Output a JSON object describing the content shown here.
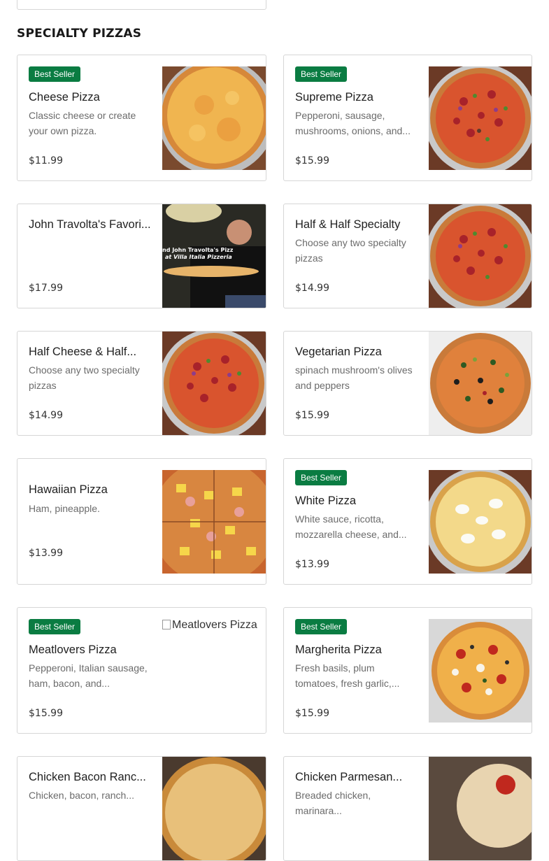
{
  "section": {
    "title": "SPECIALTY PIZZAS"
  },
  "badge_label": "Best Seller",
  "items": [
    {
      "name": "Cheese Pizza",
      "description": "Classic cheese or create your own pizza.",
      "price": "$11.99",
      "best_seller": true,
      "image": "cheese-pizza"
    },
    {
      "name": "Supreme Pizza",
      "description": "Pepperoni, sausage, mushrooms, onions, and...",
      "price": "$15.99",
      "best_seller": true,
      "image": "supreme-pizza"
    },
    {
      "name": "John Travolta's Favori...",
      "description": "",
      "price": "$17.99",
      "best_seller": false,
      "image": "john-travolta-photo",
      "image_caption": "and John Travolta's Pizza at Villa Italia Pizzeria"
    },
    {
      "name": "Half & Half Specialty",
      "description": "Choose any two specialty pizzas",
      "price": "$14.99",
      "best_seller": false,
      "image": "supreme-pizza"
    },
    {
      "name": "Half Cheese & Half...",
      "description": "Choose any two specialty pizzas",
      "price": "$14.99",
      "best_seller": false,
      "image": "supreme-pizza"
    },
    {
      "name": "Vegetarian Pizza",
      "description": "spinach mushroom's olives and peppers",
      "price": "$15.99",
      "best_seller": false,
      "image": "vegetarian-pizza"
    },
    {
      "name": "Hawaiian Pizza",
      "description": "Ham, pineapple.",
      "price": "$13.99",
      "best_seller": false,
      "image": "hawaiian-pizza"
    },
    {
      "name": "White Pizza",
      "description": "White sauce, ricotta, mozzarella cheese, and...",
      "price": "$13.99",
      "best_seller": true,
      "image": "white-pizza"
    },
    {
      "name": "Meatlovers Pizza",
      "description": "Pepperoni, Italian sausage, ham, bacon, and...",
      "price": "$15.99",
      "best_seller": true,
      "image": "broken-image",
      "image_alt": "Meatlovers Pizza"
    },
    {
      "name": "Margherita Pizza",
      "description": "Fresh basils, plum tomatoes, fresh garlic,...",
      "price": "$15.99",
      "best_seller": true,
      "image": "margherita-pizza"
    },
    {
      "name": "Chicken Bacon Ranc...",
      "description": "Chicken, bacon, ranch...",
      "price": "",
      "best_seller": false,
      "image": "chicken-bacon-pizza"
    },
    {
      "name": "Chicken Parmesan...",
      "description": "Breaded chicken, marinara...",
      "price": "",
      "best_seller": false,
      "image": "chicken-parm-pizza"
    }
  ]
}
